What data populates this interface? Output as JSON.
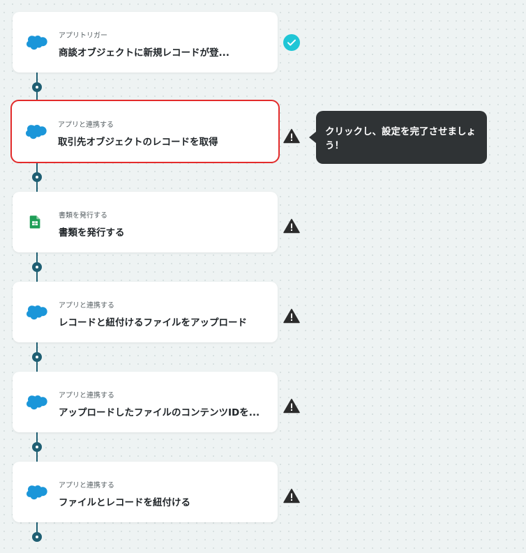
{
  "steps": [
    {
      "subtitle": "アプリトリガー",
      "title": "商談オブジェクトに新規レコードが登...",
      "icon": "salesforce-cloud-icon",
      "status": "check-icon"
    },
    {
      "subtitle": "アプリと連携する",
      "title": "取引先オブジェクトのレコードを取得",
      "icon": "salesforce-cloud-icon",
      "status": "warning-icon"
    },
    {
      "subtitle": "書類を発行する",
      "title": "書類を発行する",
      "icon": "google-sheets-icon",
      "status": "warning-icon"
    },
    {
      "subtitle": "アプリと連携する",
      "title": "レコードと紐付けるファイルをアップロード",
      "icon": "salesforce-cloud-icon",
      "status": "warning-icon"
    },
    {
      "subtitle": "アプリと連携する",
      "title": "アップロードしたファイルのコンテンツIDを...",
      "icon": "salesforce-cloud-icon",
      "status": "warning-icon"
    },
    {
      "subtitle": "アプリと連携する",
      "title": "ファイルとレコードを紐付ける",
      "icon": "salesforce-cloud-icon",
      "status": "warning-icon"
    }
  ],
  "tooltip": {
    "text": "クリックし、設定を完了させましょう！"
  },
  "colors": {
    "salesforce": "#1b96d9",
    "check": "#1fc6d6",
    "warning": "#2b2b2b",
    "sheets": "#1e9e57",
    "connector": "#1f5f73",
    "selected_border": "#e32b2b"
  }
}
